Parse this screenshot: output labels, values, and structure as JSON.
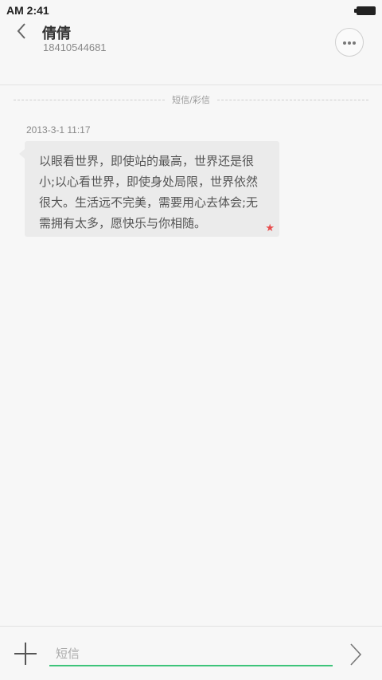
{
  "status_bar": {
    "time": "AM 2:41"
  },
  "header": {
    "contact_name": "倩倩",
    "phone_number": "18410544681",
    "back_icon": "chevron-left-icon",
    "more_icon": "more-horizontal-icon"
  },
  "conversation": {
    "divider_label": "短信/彩信",
    "messages": [
      {
        "timestamp": "2013-3-1 11:17",
        "text": "以眼看世界，即使站的最高，世界还是很小;以心看世界，即使身处局限，世界依然很大。生活远不完美，需要用心去体会;无需拥有太多，愿快乐与你相随。",
        "starred": true
      }
    ]
  },
  "composer": {
    "placeholder": "短信",
    "value": "",
    "add_icon": "plus-icon",
    "send_icon": "chevron-right-icon",
    "accent_color": "#3ec47a"
  },
  "colors": {
    "background": "#f7f7f7",
    "bubble": "#ebebeb",
    "star": "#e84c4c"
  }
}
